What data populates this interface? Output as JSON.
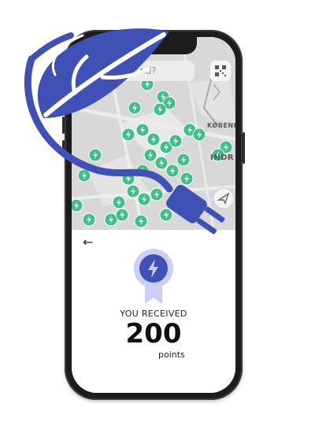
{
  "map": {
    "search_placeholder": "nd?",
    "labels": [
      "KØBENH",
      "INDR"
    ]
  },
  "reward": {
    "title": "YOU RECEIVED",
    "points": "200",
    "unit": "points"
  },
  "icons": {
    "back": "arrow-left-icon",
    "badge": "lightning-badge-icon",
    "qr": "qr-code-icon",
    "logo": "leaf-plug-icon"
  },
  "colors": {
    "brand_blue": "#3f51b5",
    "badge_light": "#c9cff5",
    "marker_green": "#3fbf8a"
  }
}
